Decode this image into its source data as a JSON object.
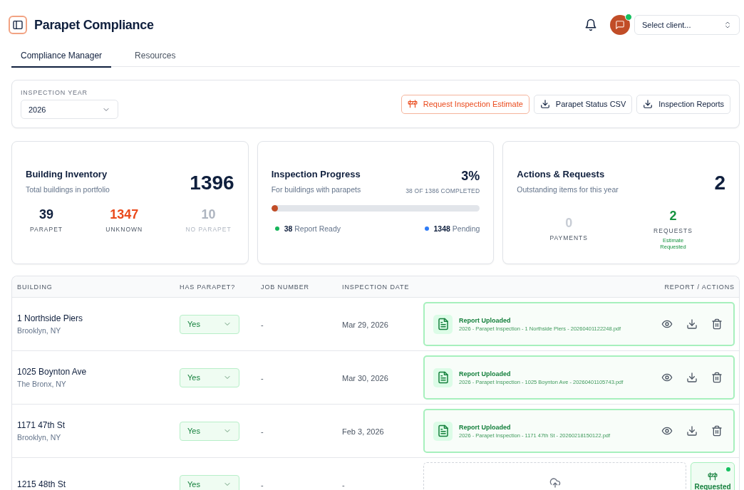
{
  "header": {
    "title": "Parapet Compliance",
    "chat_unread": true,
    "client_select": {
      "placeholder": "Select client..."
    }
  },
  "tabs": [
    {
      "label": "Compliance Manager",
      "selected": true
    },
    {
      "label": "Resources",
      "selected": false
    }
  ],
  "filter_bar": {
    "year_label": "INSPECTION YEAR",
    "year_value": "2026",
    "buttons": [
      {
        "label": "Request Inspection Estimate",
        "kind": "estimate"
      },
      {
        "label": "Parapet Status CSV",
        "kind": "download"
      },
      {
        "label": "Inspection Reports",
        "kind": "download"
      }
    ]
  },
  "inventory": {
    "title": "Building Inventory",
    "subtitle": "Total buildings in portfolio",
    "total": "1396",
    "breakdown": [
      {
        "value": "39",
        "label": "PARAPET",
        "color": "#0f1f3d"
      },
      {
        "value": "1347",
        "label": "UNKNOWN",
        "color": "#ea4a1c"
      },
      {
        "value": "10",
        "label": "NO PARAPET",
        "color": "#aeb5c0"
      }
    ]
  },
  "progress": {
    "title": "Inspection Progress",
    "subtitle": "For buildings with parapets",
    "percent": "3%",
    "completed": "38 OF 1386 COMPLETED",
    "level": 0.027,
    "legend": [
      {
        "count": "38",
        "label": "Report Ready",
        "color": "#16b55a"
      },
      {
        "count": "1348",
        "label": "Pending",
        "color": "#2f7cf6"
      }
    ]
  },
  "actions": {
    "title": "Actions & Requests",
    "subtitle": "Outstanding items for this year",
    "total": "2",
    "items": [
      {
        "value": "0",
        "label": "PAYMENTS",
        "color": "#c8cdd5"
      },
      {
        "value": "2",
        "label": "REQUESTS",
        "note": "Estimate Requested",
        "color": "#15933f"
      }
    ]
  },
  "table": {
    "columns": [
      "BUILDING",
      "HAS PARAPET?",
      "JOB NUMBER",
      "INSPECTION DATE",
      "REPORT / ACTIONS"
    ],
    "rows": [
      {
        "building": "1 Northside Piers",
        "location": "Brooklyn, NY",
        "parapet": "Yes",
        "job": "-",
        "date": "Mar 29, 2026",
        "report": {
          "kind": "uploaded",
          "status": "Report Uploaded",
          "file": "2026 - Parapet Inspection - 1 Northside Piers - 20260401122248.pdf"
        }
      },
      {
        "building": "1025 Boynton Ave",
        "location": "The Bronx, NY",
        "parapet": "Yes",
        "job": "-",
        "date": "Mar 30, 2026",
        "report": {
          "kind": "uploaded",
          "status": "Report Uploaded",
          "file": "2026 - Parapet Inspection - 1025 Boynton Ave - 20260401105743.pdf"
        }
      },
      {
        "building": "1171 47th St",
        "location": "Brooklyn, NY",
        "parapet": "Yes",
        "job": "-",
        "date": "Feb 3, 2026",
        "report": {
          "kind": "uploaded",
          "status": "Report Uploaded",
          "file": "2026 - Parapet Inspection - 1171 47th St - 20260218150122.pdf"
        }
      },
      {
        "building": "1215 48th St",
        "parapet": "Yes",
        "job": "-",
        "date": "-",
        "report": {
          "kind": "upload",
          "request": {
            "label": "Requested",
            "unread": true
          }
        }
      }
    ]
  }
}
